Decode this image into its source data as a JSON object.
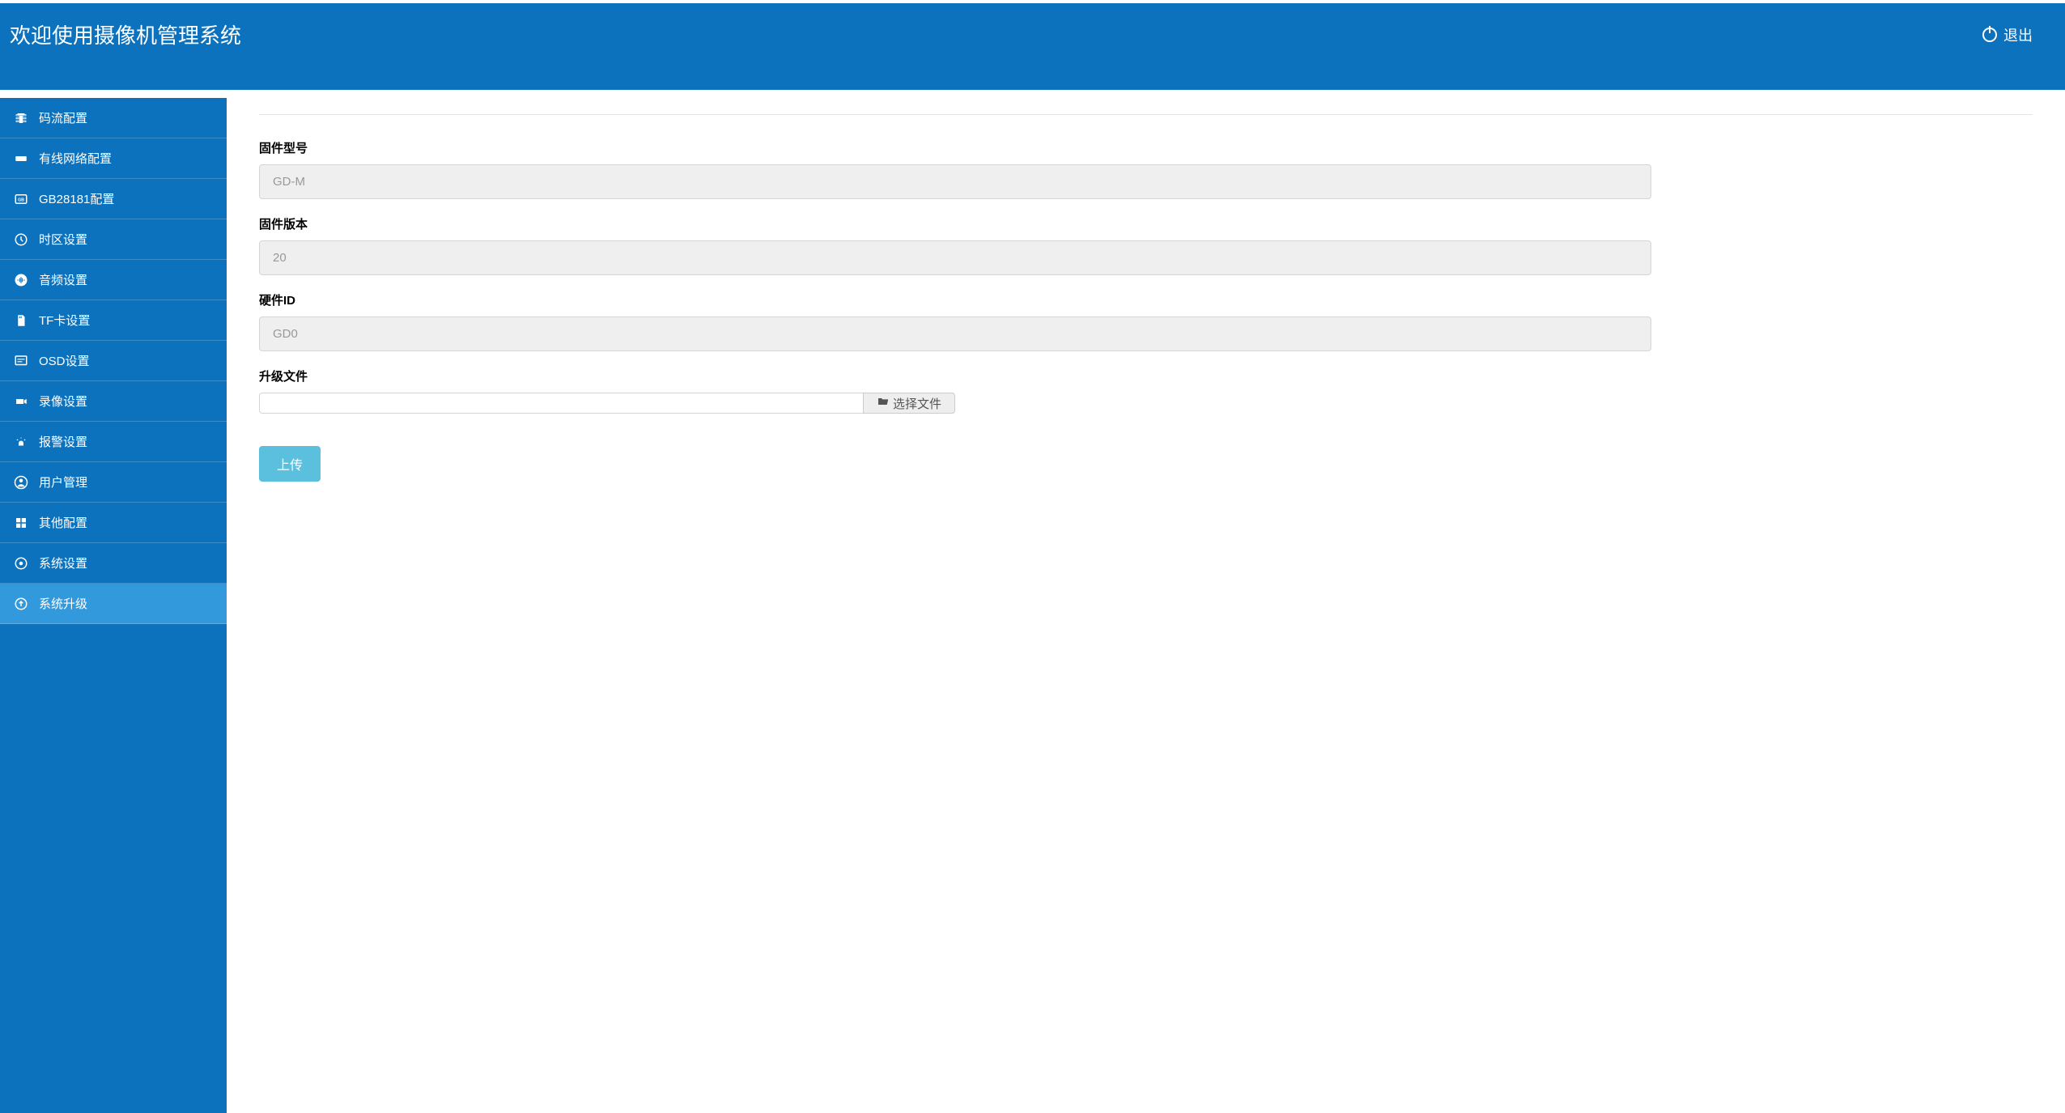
{
  "header": {
    "title": "欢迎使用摄像机管理系统",
    "logout_label": "退出"
  },
  "sidebar": {
    "items": [
      {
        "label": "码流配置",
        "icon": "stream-icon"
      },
      {
        "label": "有线网络配置",
        "icon": "network-icon"
      },
      {
        "label": "GB28181配置",
        "icon": "gb-icon"
      },
      {
        "label": "时区设置",
        "icon": "clock-icon"
      },
      {
        "label": "音频设置",
        "icon": "audio-icon"
      },
      {
        "label": "TF卡设置",
        "icon": "sdcard-icon"
      },
      {
        "label": "OSD设置",
        "icon": "osd-icon"
      },
      {
        "label": "录像设置",
        "icon": "record-icon"
      },
      {
        "label": "报警设置",
        "icon": "alarm-icon"
      },
      {
        "label": "用户管理",
        "icon": "user-icon"
      },
      {
        "label": "其他配置",
        "icon": "other-icon"
      },
      {
        "label": "系统设置",
        "icon": "system-icon"
      },
      {
        "label": "系统升级",
        "icon": "upgrade-icon",
        "active": true
      }
    ]
  },
  "main": {
    "fields": {
      "firmware_model_label": "固件型号",
      "firmware_model_value": "GD-M",
      "firmware_version_label": "固件版本",
      "firmware_version_value": "20",
      "hardware_id_label": "硬件ID",
      "hardware_id_value": "GD0",
      "upgrade_file_label": "升级文件",
      "upgrade_file_value": "",
      "file_select_button": "选择文件",
      "upload_button": "上传"
    }
  }
}
